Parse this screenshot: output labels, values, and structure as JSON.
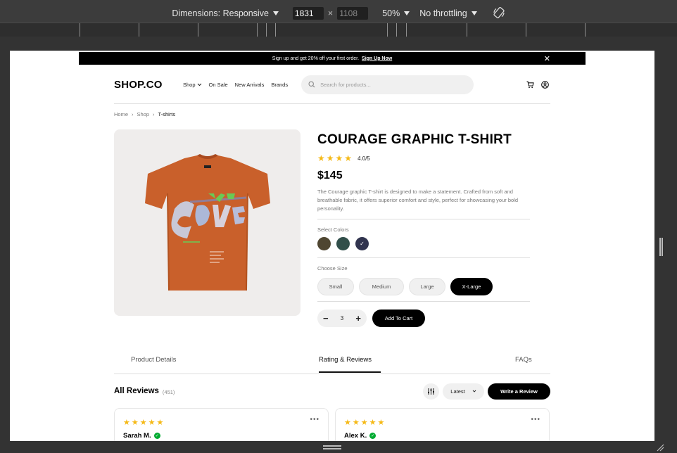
{
  "devtools": {
    "dimensions_label": "Dimensions: Responsive",
    "width_value": "1831",
    "height_value": "1108",
    "times_sign": "×",
    "zoom": "50%",
    "throttling": "No throttling"
  },
  "promo": {
    "text": "Sign up and get 20% off your first order.",
    "link": "Sign Up Now",
    "close": "✕"
  },
  "header": {
    "logo": "SHOP.CO",
    "nav": [
      "Shop",
      "On Sale",
      "New Arrivals",
      "Brands"
    ],
    "search_placeholder": "Search for products..."
  },
  "breadcrumb": [
    "Home",
    "Shop",
    "T-shirts"
  ],
  "product": {
    "title": "COURAGE GRAPHIC T-SHIRT",
    "rating": "4.0/5",
    "stars": 4,
    "price": "$145",
    "description": "The Courage graphic T-shirt is designed to make a statement. Crafted from soft and breathable fabric, it offers superior comfort and style, perfect for showcasing your bold personality.",
    "colors_label": "Select Colors",
    "colors": [
      "#4f4631",
      "#314f4a",
      "#31344f"
    ],
    "selected_color_index": 2,
    "size_label": "Choose Size",
    "sizes": [
      "Small",
      "Medium",
      "Large",
      "X-Large"
    ],
    "selected_size": "X-Large",
    "quantity": "3",
    "add_to_cart": "Add To Cart"
  },
  "tabs": [
    "Product Details",
    "Rating & Reviews",
    "FAQs"
  ],
  "active_tab": "Rating & Reviews",
  "reviews": {
    "heading": "All Reviews",
    "count": "(451)",
    "sort": "Latest",
    "write": "Write a Review",
    "items": [
      {
        "name": "Sarah M.",
        "stars": 5
      },
      {
        "name": "Alex K.",
        "stars": 5
      }
    ]
  }
}
